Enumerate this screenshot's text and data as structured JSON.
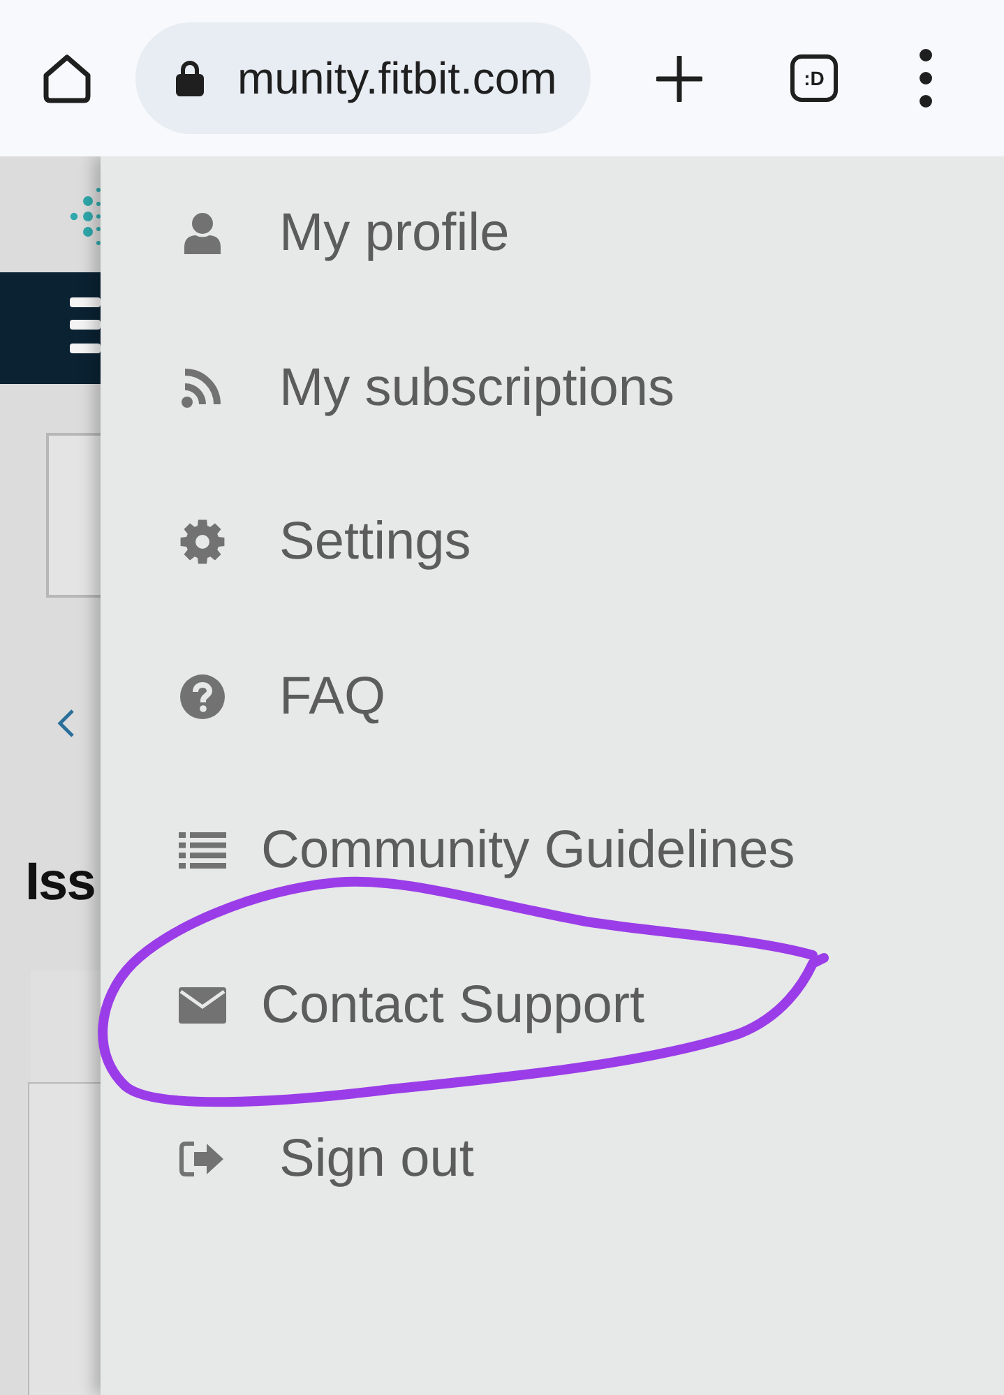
{
  "browser": {
    "url": "munity.fitbit.com",
    "tab_switcher": ":D"
  },
  "page": {
    "heading": "Iss"
  },
  "menu": {
    "items": [
      {
        "label": "My profile",
        "circled": false
      },
      {
        "label": "My subscriptions",
        "circled": false
      },
      {
        "label": "Settings",
        "circled": false
      },
      {
        "label": "FAQ",
        "circled": false
      },
      {
        "label": "Community Guidelines",
        "circled": false
      },
      {
        "label": "Contact Support",
        "circled": true
      },
      {
        "label": "Sign out",
        "circled": false
      }
    ]
  }
}
